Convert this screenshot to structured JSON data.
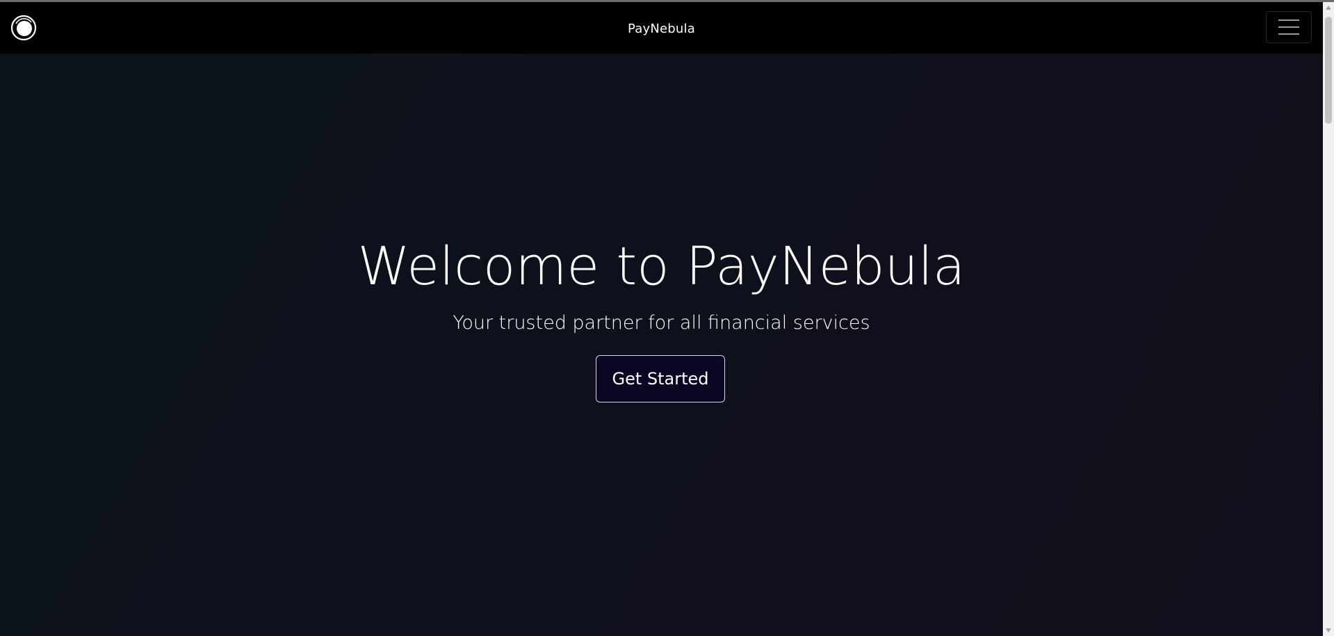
{
  "navbar": {
    "brand": "PayNebula",
    "logo_icon": "nebula-logo-icon",
    "menu_icon": "hamburger-menu-icon"
  },
  "hero": {
    "title": "Welcome to PayNebula",
    "subtitle": "Your trusted partner for all financial services",
    "cta_label": "Get Started"
  },
  "colors": {
    "navbar_bg": "#000000",
    "page_bg": "#0c1018",
    "cta_bg": "#0a0624",
    "text": "#ffffff"
  }
}
